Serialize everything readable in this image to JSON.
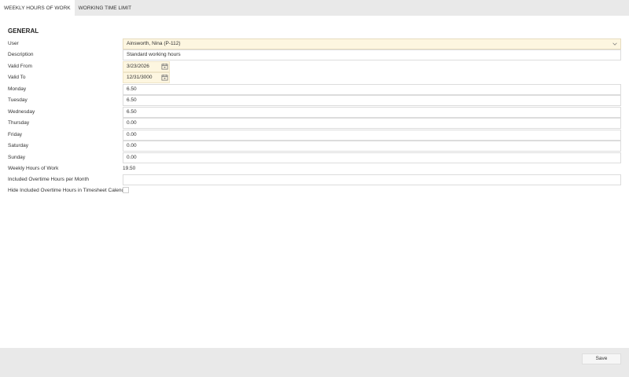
{
  "tabs": [
    {
      "label": "WEEKLY HOURS OF WORK",
      "active": true
    },
    {
      "label": "WORKING TIME LIMIT",
      "active": false
    }
  ],
  "section_title": "GENERAL",
  "form": {
    "user": {
      "label": "User",
      "value": "Ainsworth, Nina (P-112)"
    },
    "description": {
      "label": "Description",
      "value": "Standard working hours"
    },
    "valid_from": {
      "label": "Valid From",
      "value": "3/23/2026"
    },
    "valid_to": {
      "label": "Valid To",
      "value": "12/31/3000"
    },
    "monday": {
      "label": "Monday",
      "value": "6.50"
    },
    "tuesday": {
      "label": "Tuesday",
      "value": "6.50"
    },
    "wednesday": {
      "label": "Wednesday",
      "value": "6.50"
    },
    "thursday": {
      "label": "Thursday",
      "value": "0.00"
    },
    "friday": {
      "label": "Friday",
      "value": "0.00"
    },
    "saturday": {
      "label": "Saturday",
      "value": "0.00"
    },
    "sunday": {
      "label": "Sunday",
      "value": "0.00"
    },
    "weekly_hours": {
      "label": "Weekly Hours of Work",
      "value": "19.50"
    },
    "included_overtime": {
      "label": "Included Overtime Hours per Month",
      "value": ""
    },
    "hide_overtime": {
      "label": "Hide Included Overtime Hours in Timesheet Calendar",
      "checked": false
    }
  },
  "footer": {
    "save_label": "Save"
  },
  "icons": {
    "dropdown": "chevron-down-icon",
    "calendar": "calendar-icon"
  },
  "colors": {
    "tabbar": "#e9e9e9",
    "highlight_field": "#fdf6e0",
    "footer": "#e9e9e9"
  }
}
